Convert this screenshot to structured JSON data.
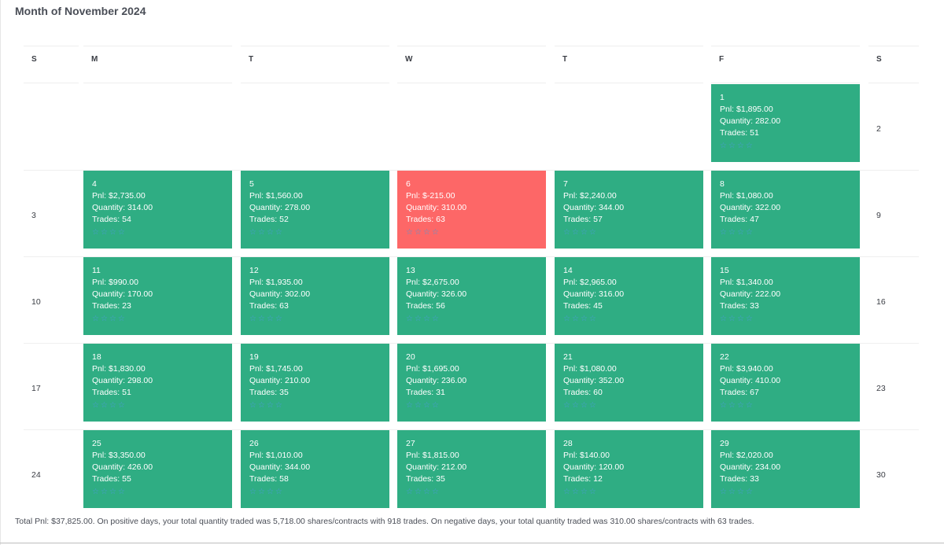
{
  "title": "Month of November 2024",
  "headers": [
    "S",
    "M",
    "T",
    "W",
    "T",
    "F",
    "S"
  ],
  "sundays": [
    "3",
    "10",
    "17",
    "24"
  ],
  "saturdays": [
    "2",
    "9",
    "16",
    "23",
    "30"
  ],
  "labels": {
    "pnl": "Pnl: ",
    "qty": "Quantity: ",
    "trades": "Trades: "
  },
  "star_icon": "star-icon",
  "colors": {
    "positive": "#2fad83",
    "negative": "#fd6767",
    "star": "#4a9ad8"
  },
  "days": [
    {
      "day": "1",
      "pnl": "$1,895.00",
      "qty": "282.00",
      "trades": "51",
      "negative": false
    },
    {
      "day": "4",
      "pnl": "$2,735.00",
      "qty": "314.00",
      "trades": "54",
      "negative": false
    },
    {
      "day": "5",
      "pnl": "$1,560.00",
      "qty": "278.00",
      "trades": "52",
      "negative": false
    },
    {
      "day": "6",
      "pnl": "$-215.00",
      "qty": "310.00",
      "trades": "63",
      "negative": true
    },
    {
      "day": "7",
      "pnl": "$2,240.00",
      "qty": "344.00",
      "trades": "57",
      "negative": false
    },
    {
      "day": "8",
      "pnl": "$1,080.00",
      "qty": "322.00",
      "trades": "47",
      "negative": false
    },
    {
      "day": "11",
      "pnl": "$990.00",
      "qty": "170.00",
      "trades": "23",
      "negative": false
    },
    {
      "day": "12",
      "pnl": "$1,935.00",
      "qty": "302.00",
      "trades": "63",
      "negative": false
    },
    {
      "day": "13",
      "pnl": "$2,675.00",
      "qty": "326.00",
      "trades": "56",
      "negative": false
    },
    {
      "day": "14",
      "pnl": "$2,965.00",
      "qty": "316.00",
      "trades": "45",
      "negative": false
    },
    {
      "day": "15",
      "pnl": "$1,340.00",
      "qty": "222.00",
      "trades": "33",
      "negative": false
    },
    {
      "day": "18",
      "pnl": "$1,830.00",
      "qty": "298.00",
      "trades": "51",
      "negative": false
    },
    {
      "day": "19",
      "pnl": "$1,745.00",
      "qty": "210.00",
      "trades": "35",
      "negative": false
    },
    {
      "day": "20",
      "pnl": "$1,695.00",
      "qty": "236.00",
      "trades": "31",
      "negative": false
    },
    {
      "day": "21",
      "pnl": "$1,080.00",
      "qty": "352.00",
      "trades": "60",
      "negative": false
    },
    {
      "day": "22",
      "pnl": "$3,940.00",
      "qty": "410.00",
      "trades": "67",
      "negative": false
    },
    {
      "day": "25",
      "pnl": "$3,350.00",
      "qty": "426.00",
      "trades": "55",
      "negative": false
    },
    {
      "day": "26",
      "pnl": "$1,010.00",
      "qty": "344.00",
      "trades": "58",
      "negative": false
    },
    {
      "day": "27",
      "pnl": "$1,815.00",
      "qty": "212.00",
      "trades": "35",
      "negative": false
    },
    {
      "day": "28",
      "pnl": "$140.00",
      "qty": "120.00",
      "trades": "12",
      "negative": false
    },
    {
      "day": "29",
      "pnl": "$2,020.00",
      "qty": "234.00",
      "trades": "33",
      "negative": false
    }
  ],
  "footer": "Total Pnl: $37,825.00. On positive days, your total quantity traded was 5,718.00 shares/contracts with 918 trades. On negative days, your total quantity traded was 310.00 shares/contracts with 63 trades."
}
